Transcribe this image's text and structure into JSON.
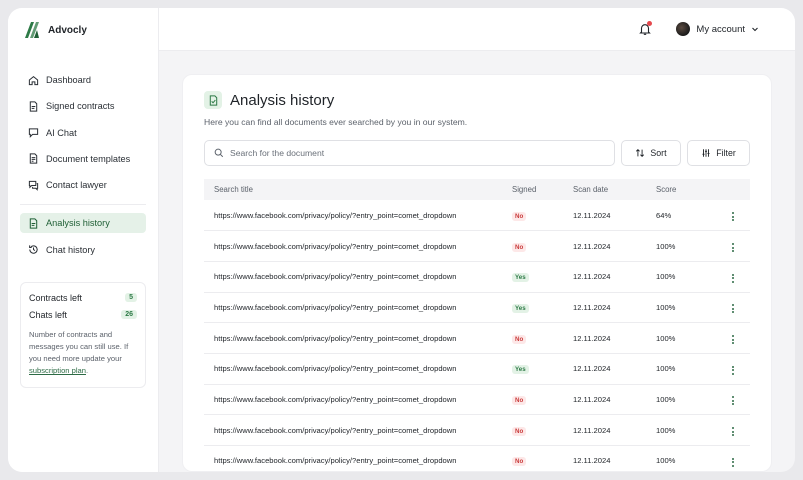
{
  "brand": {
    "name": "Advocly",
    "accent": "#2d7a46"
  },
  "sidebar": {
    "items": [
      {
        "label": "Dashboard",
        "icon": "home-icon"
      },
      {
        "label": "Signed contracts",
        "icon": "document-icon"
      },
      {
        "label": "AI Chat",
        "icon": "chat-icon"
      },
      {
        "label": "Document templates",
        "icon": "template-icon"
      },
      {
        "label": "Contact lawyer",
        "icon": "chat-lawyer-icon"
      }
    ],
    "secondary": [
      {
        "label": "Analysis history",
        "icon": "document-icon",
        "active": true
      },
      {
        "label": "Chat history",
        "icon": "history-icon"
      }
    ],
    "usage": {
      "contracts_label": "Contracts left",
      "contracts_value": "5",
      "chats_label": "Chats left",
      "chats_value": "26",
      "note": "Number of contracts and messages you can still use. If you need more update your",
      "link": "subscription plan",
      "note_end": "."
    }
  },
  "header": {
    "account_label": "My account",
    "notification_color": "#e5484d"
  },
  "page": {
    "title": "Analysis history",
    "subtitle": "Here you can find all documents ever searched by you in our system.",
    "search_placeholder": "Search for the document",
    "sort_label": "Sort",
    "filter_label": "Filter"
  },
  "table": {
    "columns": [
      "Search title",
      "Signed",
      "Scan date",
      "Score"
    ],
    "rows": [
      {
        "title": "https://www.facebook.com/privacy/policy/?entry_point=comet_dropdown",
        "signed": "No",
        "date": "12.11.2024",
        "score": "64%"
      },
      {
        "title": "https://www.facebook.com/privacy/policy/?entry_point=comet_dropdown",
        "signed": "No",
        "date": "12.11.2024",
        "score": "100%"
      },
      {
        "title": "https://www.facebook.com/privacy/policy/?entry_point=comet_dropdown",
        "signed": "Yes",
        "date": "12.11.2024",
        "score": "100%"
      },
      {
        "title": "https://www.facebook.com/privacy/policy/?entry_point=comet_dropdown",
        "signed": "Yes",
        "date": "12.11.2024",
        "score": "100%"
      },
      {
        "title": "https://www.facebook.com/privacy/policy/?entry_point=comet_dropdown",
        "signed": "No",
        "date": "12.11.2024",
        "score": "100%"
      },
      {
        "title": "https://www.facebook.com/privacy/policy/?entry_point=comet_dropdown",
        "signed": "Yes",
        "date": "12.11.2024",
        "score": "100%"
      },
      {
        "title": "https://www.facebook.com/privacy/policy/?entry_point=comet_dropdown",
        "signed": "No",
        "date": "12.11.2024",
        "score": "100%"
      },
      {
        "title": "https://www.facebook.com/privacy/policy/?entry_point=comet_dropdown",
        "signed": "No",
        "date": "12.11.2024",
        "score": "100%"
      },
      {
        "title": "https://www.facebook.com/privacy/policy/?entry_point=comet_dropdown",
        "signed": "No",
        "date": "12.11.2024",
        "score": "100%"
      }
    ]
  }
}
